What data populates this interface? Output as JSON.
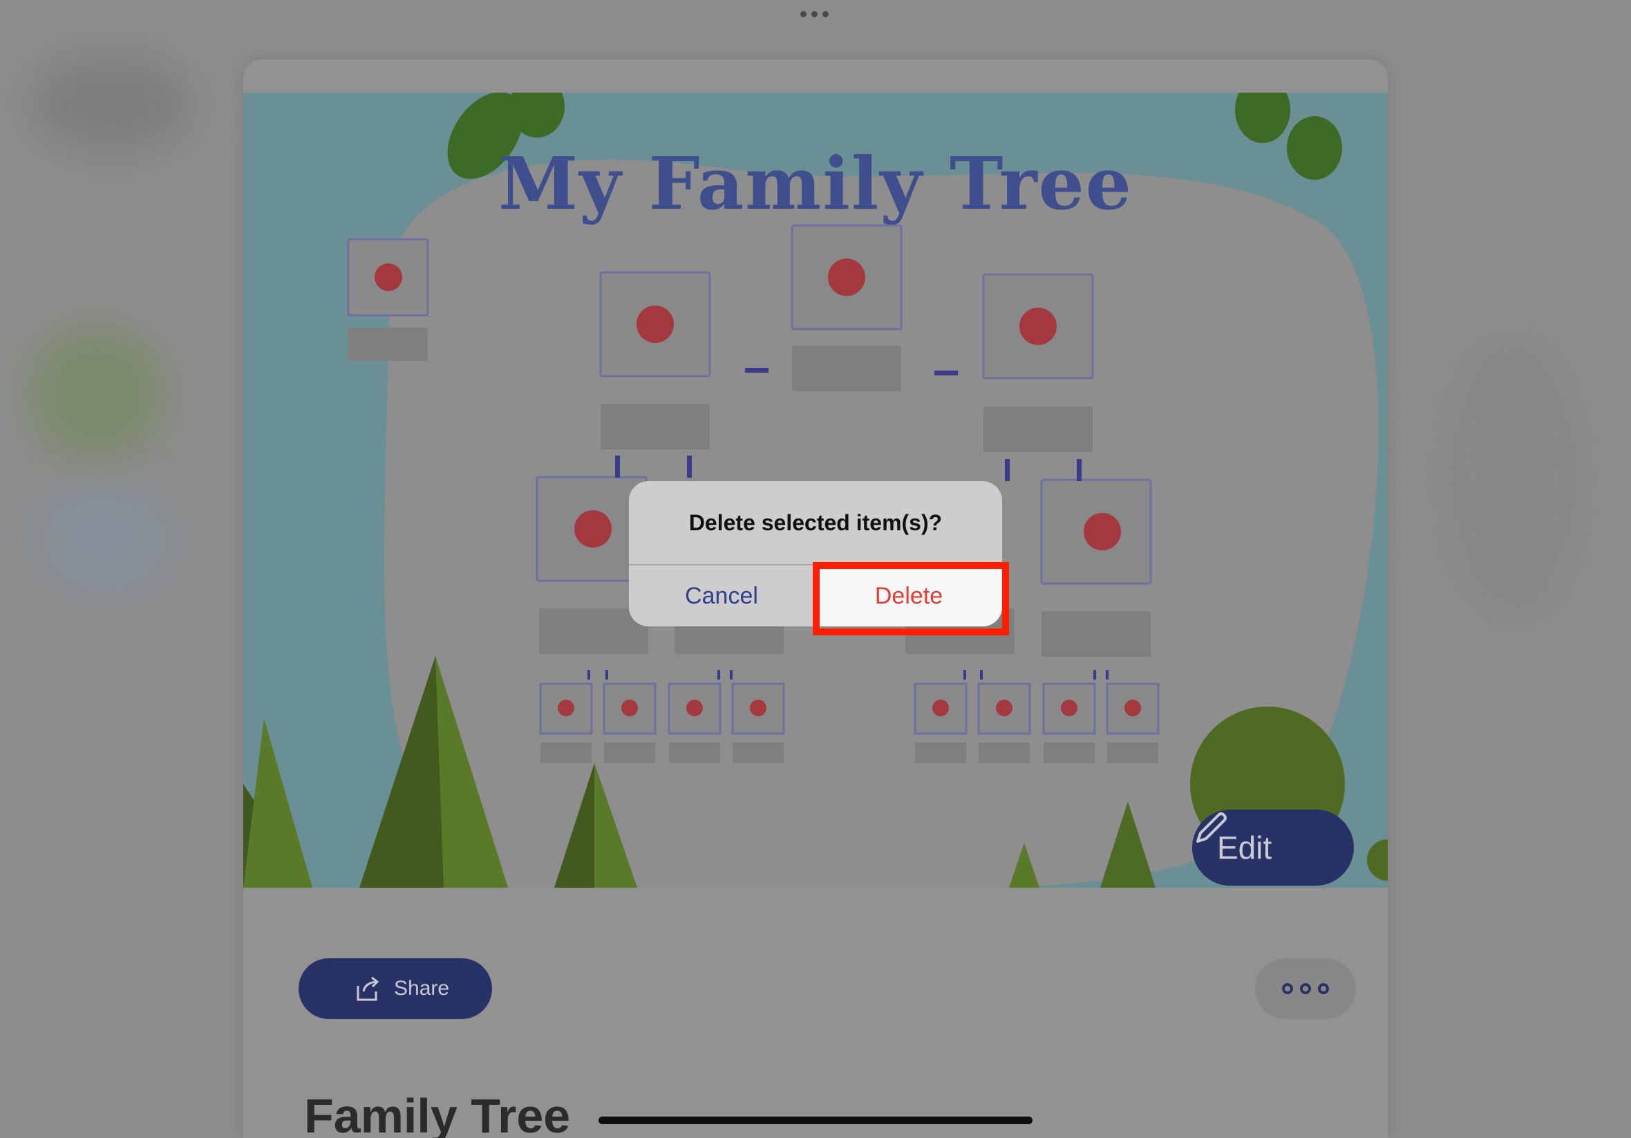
{
  "template": {
    "heading": "My Family Tree",
    "edit_label": "Edit"
  },
  "actions": {
    "share_label": "Share"
  },
  "document": {
    "title": "Family Tree"
  },
  "dialog": {
    "message": "Delete selected item(s)?",
    "cancel_label": "Cancel",
    "delete_label": "Delete"
  },
  "colors": {
    "brand_navy": "#283266",
    "destructive": "#e83b32",
    "highlight": "#ff1e00"
  }
}
